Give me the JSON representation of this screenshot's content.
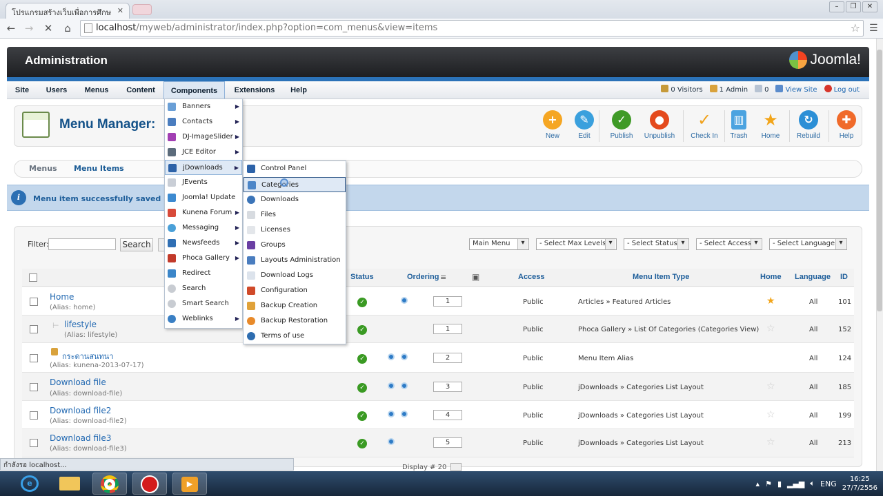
{
  "browser": {
    "tab_title": "โปรแกรมสร้างเว็บเพื่อการศึกษ",
    "url_host": "localhost",
    "url_path": "/myweb/administrator/index.php?option=com_menus&view=items"
  },
  "header": {
    "title": "Administration",
    "logo": "Joomla!"
  },
  "menu": {
    "items": [
      "Site",
      "Users",
      "Menus",
      "Content",
      "Components",
      "Extensions",
      "Help"
    ],
    "status": {
      "visitors": "0 Visitors",
      "admins": "1 Admin",
      "messages": "0",
      "view_site": "View Site",
      "logout": "Log out"
    }
  },
  "page": {
    "title": "Menu Manager:"
  },
  "toolbar": [
    "New",
    "Edit",
    "Publish",
    "Unpublish",
    "Check In",
    "Trash",
    "Home",
    "Rebuild",
    "Help"
  ],
  "subtabs": [
    "Menus",
    "Menu Items"
  ],
  "message": "Menu item successfully saved",
  "filter": {
    "label": "Filter:",
    "search": "Search"
  },
  "selects": [
    "Main Menu",
    "- Select Max Levels -",
    "- Select Status -",
    "- Select Access -",
    "- Select Language -"
  ],
  "columns": {
    "status": "Status",
    "ordering": "Ordering",
    "access": "Access",
    "type": "Menu Item Type",
    "home": "Home",
    "language": "Language",
    "id": "ID"
  },
  "rows": [
    {
      "title": "Home",
      "alias": "(Alias: home)",
      "order": "1",
      "access": "Public",
      "type": "Articles » Featured Articles",
      "lang": "All",
      "id": "101"
    },
    {
      "title": "lifestyle",
      "alias": "(Alias: lifestyle)",
      "order": "1",
      "access": "Public",
      "type": "Phoca Gallery » List Of Categories (Categories View)",
      "lang": "All",
      "id": "152"
    },
    {
      "title": "กระดานสนทนา",
      "alias": "(Alias: kunena-2013-07-17)",
      "order": "2",
      "access": "Public",
      "type": "Menu Item Alias",
      "lang": "All",
      "id": "124"
    },
    {
      "title": "Download file",
      "alias": "(Alias: download-file)",
      "order": "3",
      "access": "Public",
      "type": "jDownloads » Categories List Layout",
      "lang": "All",
      "id": "185"
    },
    {
      "title": "Download file2",
      "alias": "(Alias: download-file2)",
      "order": "4",
      "access": "Public",
      "type": "jDownloads » Categories List Layout",
      "lang": "All",
      "id": "199"
    },
    {
      "title": "Download file3",
      "alias": "(Alias: download-file3)",
      "order": "5",
      "access": "Public",
      "type": "jDownloads » Categories List Layout",
      "lang": "All",
      "id": "213"
    }
  ],
  "components_menu": [
    "Banners",
    "Contacts",
    "DJ-ImageSlider",
    "JCE Editor",
    "jDownloads",
    "JEvents",
    "Joomla! Update",
    "Kunena Forum",
    "Messaging",
    "Newsfeeds",
    "Phoca Gallery",
    "Redirect",
    "Search",
    "Smart Search",
    "Weblinks"
  ],
  "jdownloads_menu": [
    "Control Panel",
    "Categories",
    "Downloads",
    "Files",
    "Licenses",
    "Groups",
    "Layouts Administration",
    "Download Logs",
    "Configuration",
    "Backup Creation",
    "Backup Restoration",
    "Terms of use"
  ],
  "footer": {
    "status_text": "กำลังรอ localhost...",
    "display": "Display # 20"
  },
  "taskbar": {
    "lang": "ENG",
    "time": "16:25",
    "date": "27/7/2556"
  }
}
